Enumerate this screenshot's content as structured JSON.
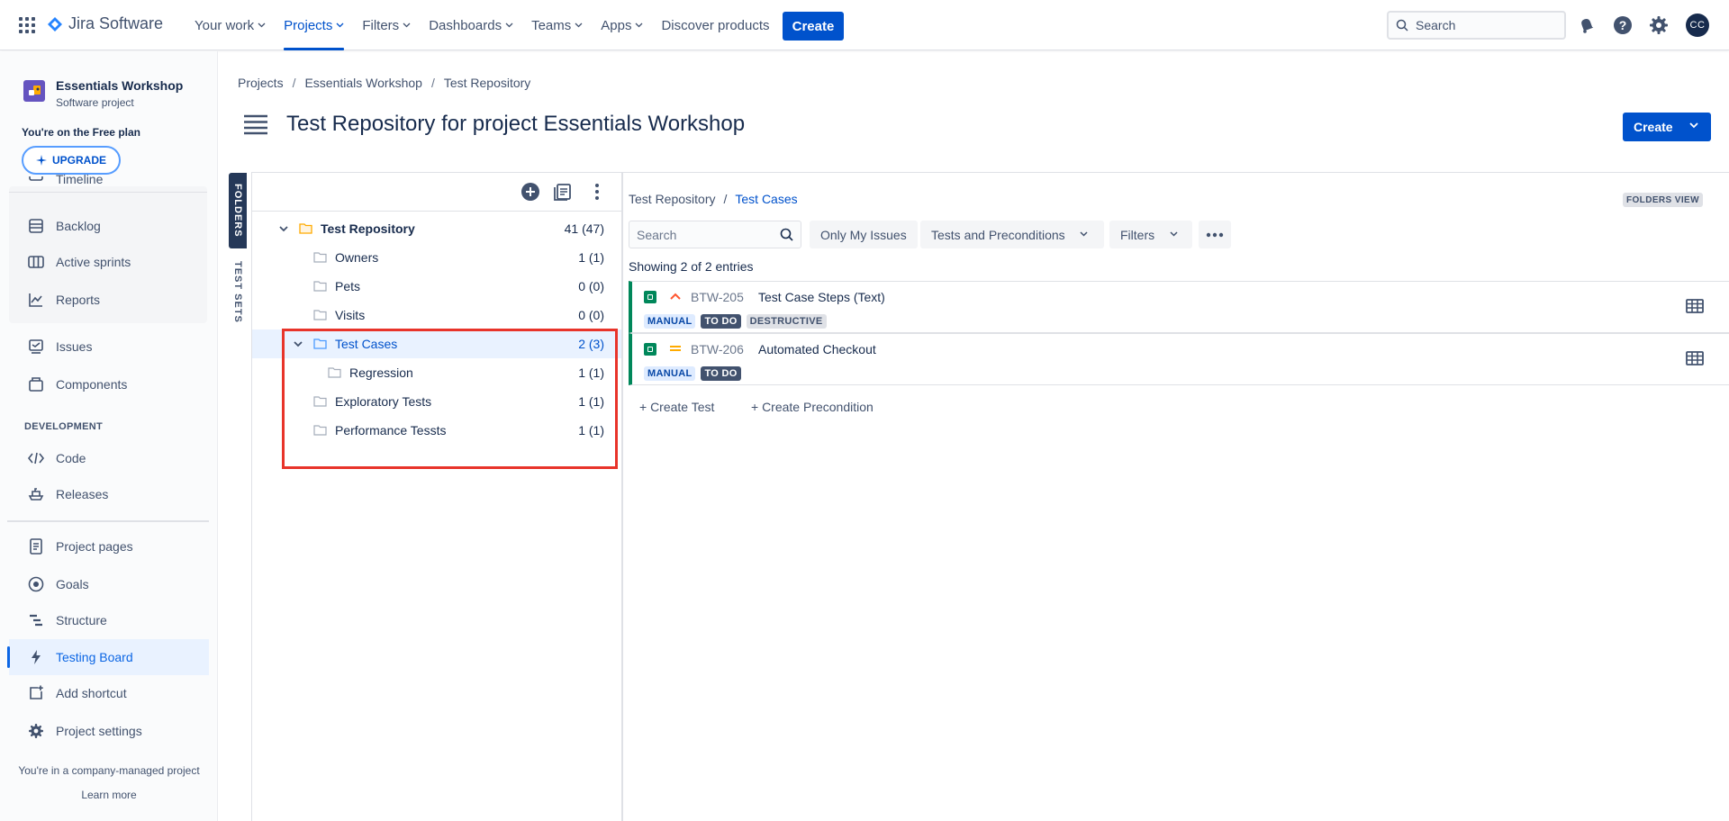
{
  "topnav": {
    "logo_text": "Jira Software",
    "items": [
      {
        "label": "Your work"
      },
      {
        "label": "Projects"
      },
      {
        "label": "Filters"
      },
      {
        "label": "Dashboards"
      },
      {
        "label": "Teams"
      },
      {
        "label": "Apps"
      }
    ],
    "discover": "Discover products",
    "create": "Create",
    "search_placeholder": "Search",
    "avatar_initials": "CC"
  },
  "sidebar": {
    "project_name": "Essentials Workshop",
    "project_type": "Software project",
    "plan_text": "You're on the Free plan",
    "upgrade": "UPGRADE",
    "cut_item": "Timeline",
    "items": [
      {
        "label": "Backlog"
      },
      {
        "label": "Active sprints"
      },
      {
        "label": "Reports"
      },
      {
        "label": "Issues"
      },
      {
        "label": "Components"
      }
    ],
    "section": "DEVELOPMENT",
    "dev_items": [
      {
        "label": "Code"
      },
      {
        "label": "Releases"
      }
    ],
    "more_items": [
      {
        "label": "Project pages"
      },
      {
        "label": "Goals"
      },
      {
        "label": "Structure"
      },
      {
        "label": "Testing Board"
      },
      {
        "label": "Add shortcut"
      },
      {
        "label": "Project settings"
      }
    ],
    "footer_text": "You're in a company-managed project",
    "learn_more": "Learn more"
  },
  "header": {
    "breadcrumbs": [
      "Projects",
      "Essentials Workshop",
      "Test Repository"
    ],
    "title": "Test Repository for project Essentials Workshop",
    "create": "Create"
  },
  "vtabs": {
    "folders": "FOLDERS",
    "test_sets": "TEST SETS"
  },
  "tree": [
    {
      "label": "Test Repository",
      "count": "41 (47)"
    },
    {
      "label": "Owners",
      "count": "1 (1)"
    },
    {
      "label": "Pets",
      "count": "0 (0)"
    },
    {
      "label": "Visits",
      "count": "0 (0)"
    },
    {
      "label": "Test Cases",
      "count": "2 (3)"
    },
    {
      "label": "Regression",
      "count": "1 (1)"
    },
    {
      "label": "Exploratory Tests",
      "count": "1 (1)"
    },
    {
      "label": "Performance Tessts",
      "count": "1 (1)"
    }
  ],
  "right": {
    "breadcrumbs": [
      "Test Repository",
      "Test Cases"
    ],
    "view_badge": "FOLDERS VIEW",
    "search_placeholder": "Search",
    "only_my_issues": "Only My Issues",
    "tests_and_preconditions": "Tests and Preconditions",
    "filters": "Filters",
    "entries": "Showing 2 of 2 entries",
    "tests": [
      {
        "key": "BTW-205",
        "summary": "Test Case Steps (Text)",
        "badges": [
          "MANUAL",
          "TO DO",
          "DESTRUCTIVE"
        ]
      },
      {
        "key": "BTW-206",
        "summary": "Automated Checkout",
        "badges": [
          "MANUAL",
          "TO DO"
        ]
      }
    ],
    "create_test": "+ Create Test",
    "create_precondition": "+ Create Precondition"
  }
}
